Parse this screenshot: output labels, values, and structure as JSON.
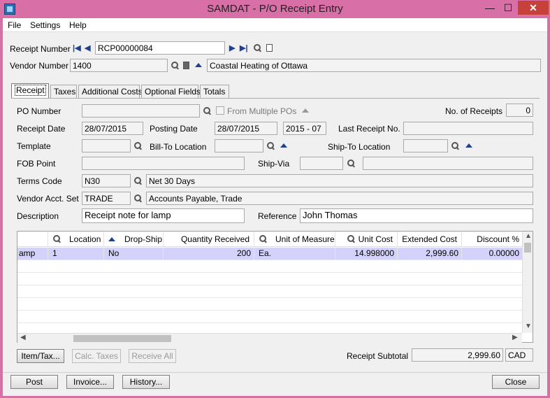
{
  "window": {
    "title": "SAMDAT - P/O Receipt Entry",
    "min_glyph": "—",
    "max_glyph": "☐",
    "close_glyph": "✕"
  },
  "menu": [
    "File",
    "Settings",
    "Help"
  ],
  "header": {
    "receipt_number_label": "Receipt Number",
    "receipt_number": "RCP00000084",
    "vendor_number_label": "Vendor Number",
    "vendor_number": "1400",
    "vendor_name": "Coastal Heating of Ottawa"
  },
  "tabs": [
    "Receipt",
    "Taxes",
    "Additional Costs",
    "Optional Fields",
    "Totals"
  ],
  "receipt": {
    "po_number_label": "PO Number",
    "po_number": "",
    "from_multiple_pos_label": "From Multiple POs",
    "no_of_receipts_label": "No. of Receipts",
    "no_of_receipts": "0",
    "receipt_date_label": "Receipt Date",
    "receipt_date": "28/07/2015",
    "posting_date_label": "Posting Date",
    "posting_date": "28/07/2015",
    "fiscal_period": "2015 - 07",
    "last_receipt_no_label": "Last Receipt No.",
    "last_receipt_no": "",
    "template_label": "Template",
    "bill_to_label": "Bill-To Location",
    "ship_to_label": "Ship-To Location",
    "fob_point_label": "FOB Point",
    "ship_via_label": "Ship-Via",
    "terms_code_label": "Terms Code",
    "terms_code": "N30",
    "terms_desc": "Net 30 Days",
    "vendor_acct_set_label": "Vendor Acct. Set",
    "vendor_acct_set": "TRADE",
    "vendor_acct_set_desc": "Accounts Payable, Trade",
    "description_label": "Description",
    "description": "Receipt note for lamp",
    "reference_label": "Reference",
    "reference": "John Thomas"
  },
  "grid": {
    "columns": [
      "Location",
      "Drop-Ship",
      "Quantity Received",
      "Unit of Measure",
      "Unit Cost",
      "Extended Cost",
      "Discount %"
    ],
    "rows": [
      {
        "item": "amp",
        "location": "1",
        "drop_ship": "No",
        "qty": "200",
        "uom": "Ea.",
        "unit_cost": "14.998000",
        "extended_cost": "2,999.60",
        "discount": "0.00000"
      }
    ]
  },
  "grid_buttons": {
    "item_tax": "Item/Tax...",
    "calc_taxes": "Calc. Taxes",
    "receive_all": "Receive All"
  },
  "subtotal": {
    "label": "Receipt Subtotal",
    "value": "2,999.60",
    "currency": "CAD"
  },
  "footer_buttons": {
    "post": "Post",
    "invoice": "Invoice...",
    "history": "History...",
    "close": "Close"
  }
}
